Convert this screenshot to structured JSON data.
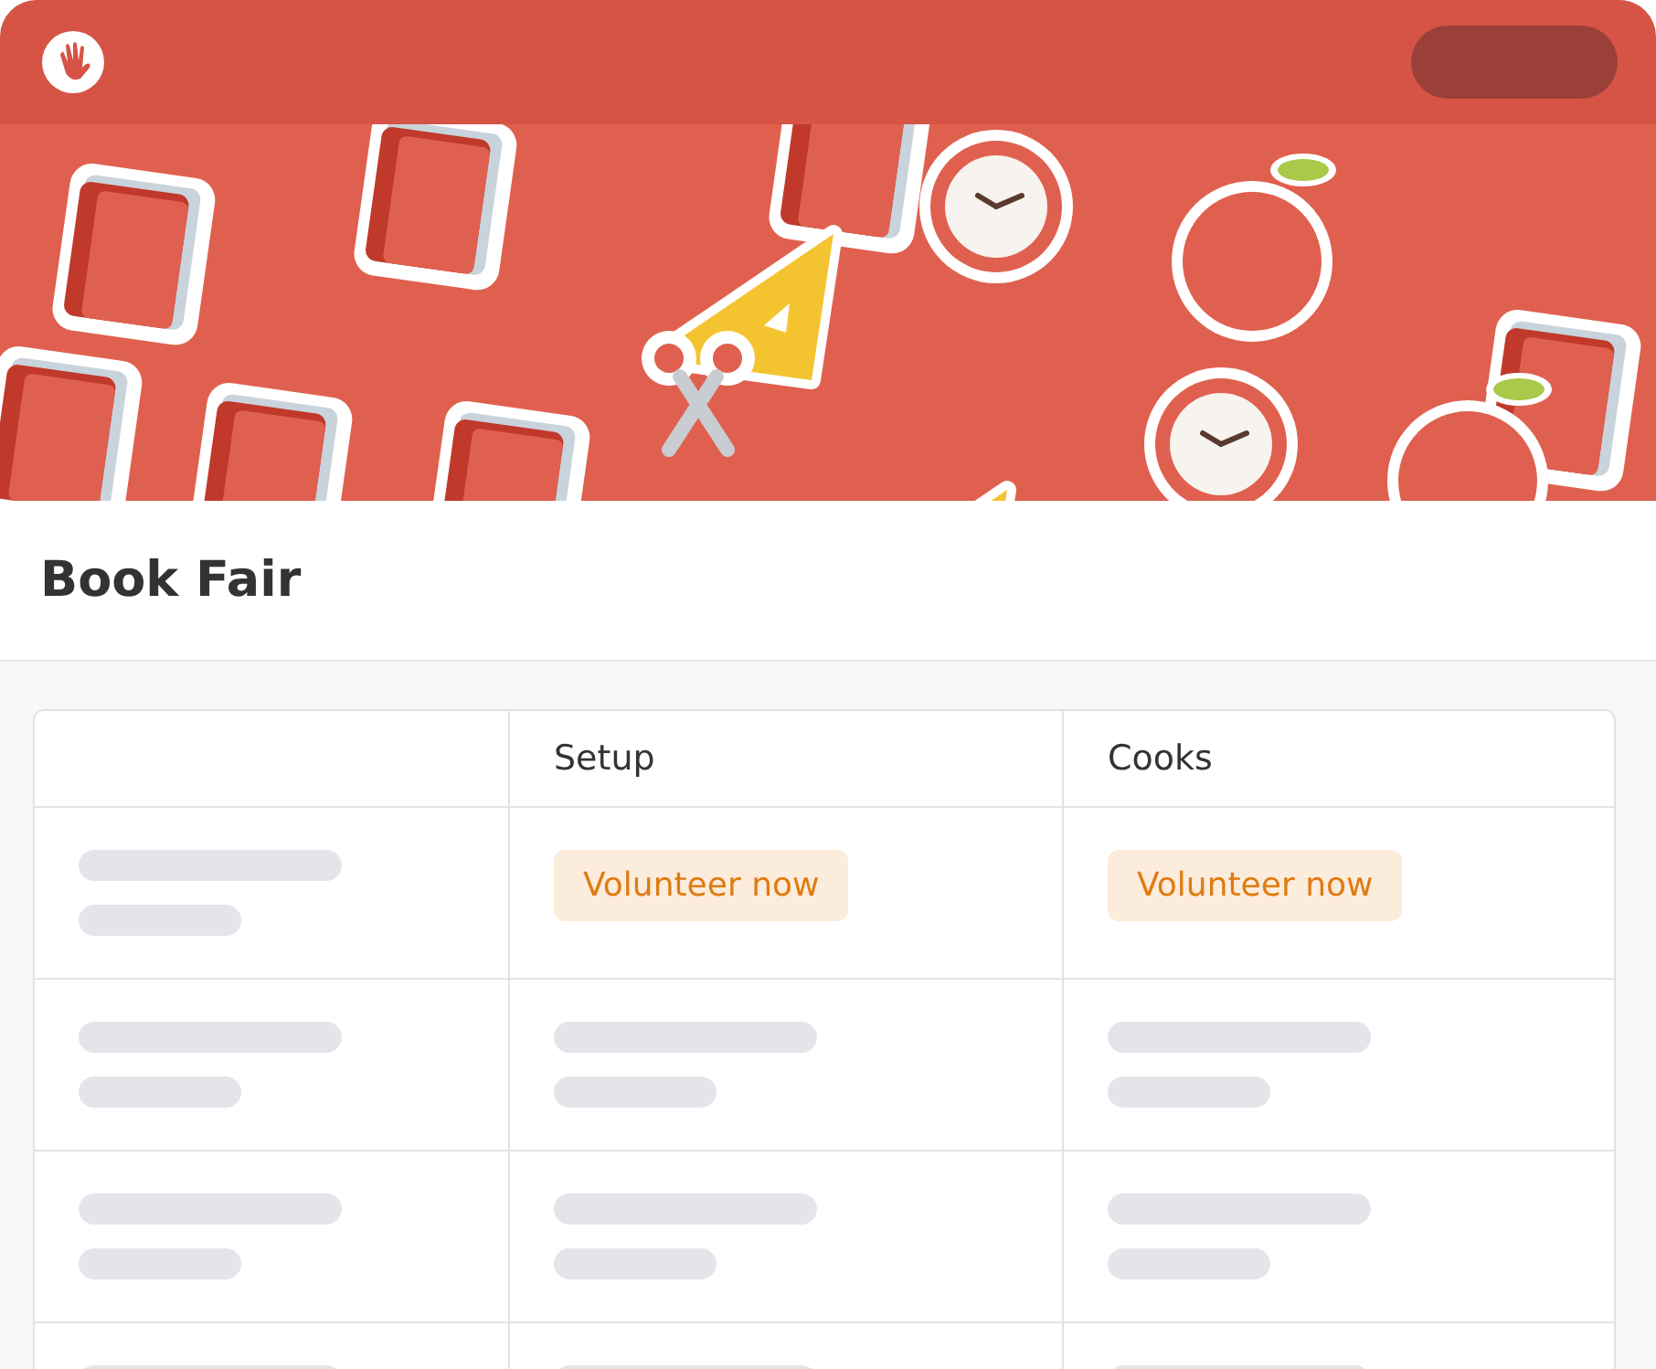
{
  "page": {
    "title": "Book Fair"
  },
  "table": {
    "columns": [
      "",
      "Setup",
      "Cooks"
    ],
    "rows": [
      {
        "cells": [
          {
            "kind": "skeleton"
          },
          {
            "kind": "button",
            "label": "Volunteer now"
          },
          {
            "kind": "button",
            "label": "Volunteer now"
          }
        ]
      },
      {
        "cells": [
          {
            "kind": "skeleton"
          },
          {
            "kind": "skeleton"
          },
          {
            "kind": "skeleton"
          }
        ]
      },
      {
        "cells": [
          {
            "kind": "skeleton"
          },
          {
            "kind": "skeleton"
          },
          {
            "kind": "skeleton"
          }
        ]
      },
      {
        "cells": [
          {
            "kind": "skeleton-top"
          },
          {
            "kind": "skeleton-top"
          },
          {
            "kind": "skeleton-top"
          }
        ]
      }
    ]
  }
}
